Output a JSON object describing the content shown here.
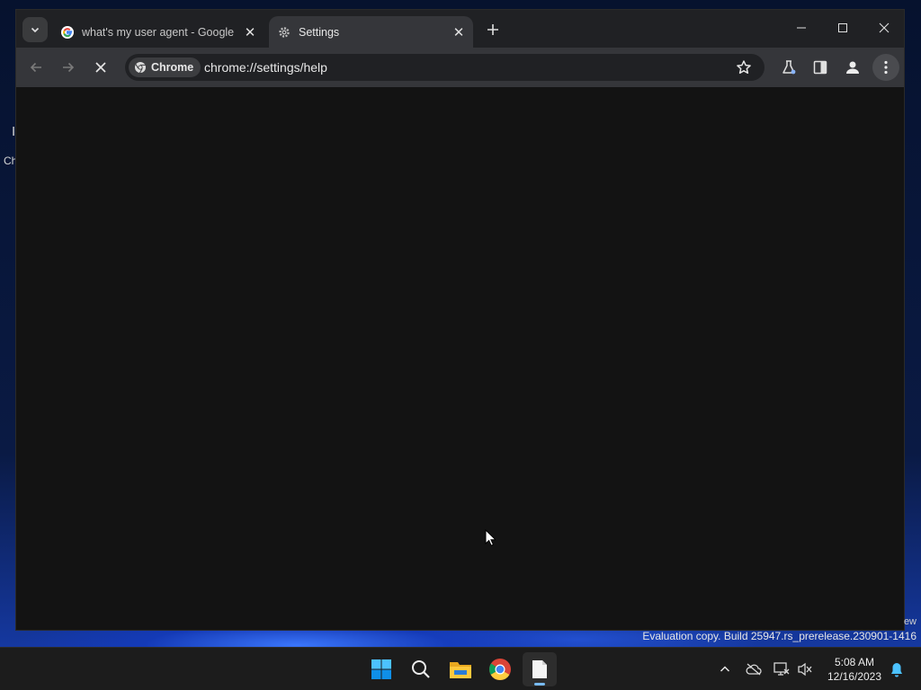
{
  "desktop": {
    "behind_window_text_1": "I",
    "behind_window_text_2": "Ch",
    "watermark_top": "ew",
    "watermark": "Evaluation copy. Build 25947.rs_prerelease.230901-1416"
  },
  "browser": {
    "tabs": [
      {
        "title": "what's my user agent - Google",
        "favicon": "google-icon",
        "active": false
      },
      {
        "title": "Settings",
        "favicon": "settings-gear-icon",
        "active": true
      }
    ],
    "omnibox": {
      "chip_label": "Chrome",
      "url": "chrome://settings/help"
    },
    "page_loading": true
  },
  "taskbar": {
    "apps": [
      "windows-start-icon",
      "search-icon",
      "file-explorer-icon",
      "chrome-icon",
      "notepad-icon"
    ],
    "clock": {
      "time": "5:08 AM",
      "date": "12/16/2023"
    }
  },
  "colors": {
    "tabstrip": "#202124",
    "toolbar": "#35363a",
    "content": "#131313",
    "taskbar": "#1c1c1c"
  }
}
